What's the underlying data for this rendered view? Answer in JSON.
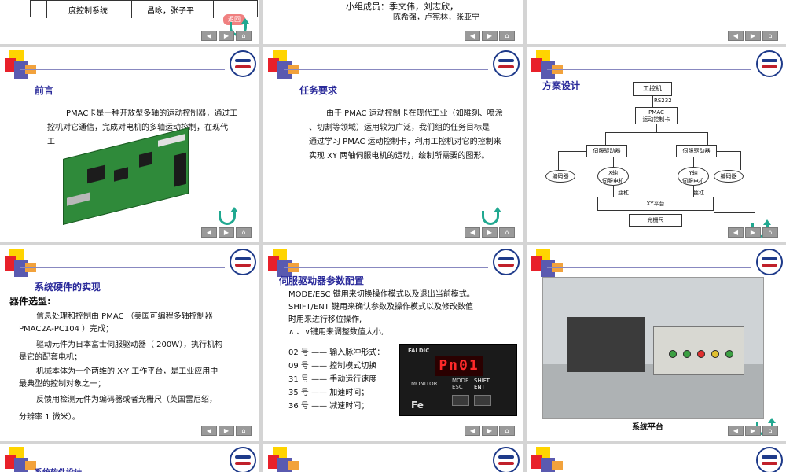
{
  "navbar": {
    "prev": "◀",
    "next": "▶",
    "home": "⌂"
  },
  "slide_top_left": {
    "row_cell_1": "度控制系统",
    "row_cell_2": "昌咏，张子平",
    "badge": "返回"
  },
  "slide_top_mid": {
    "members_label": "小组成员：季文伟，刘志欣，",
    "members_line2": "陈希强，卢宪林，张亚宁"
  },
  "slide_preface": {
    "title": "前言",
    "text_line1": "PMAC卡是一种开放型多轴的运动控制器，通过工",
    "text_line2": "控机对它通信，完成对电机的多轴运动控制，在现代",
    "text_line3": "工"
  },
  "slide_task": {
    "title": "任务要求",
    "text_line1": "由于 PMAC 运动控制卡在现代工业（如雕刻、喷涂",
    "text_line2": "、切割等领域）运用较为广泛，我们组的任务目标是",
    "text_line3": "通过学习 PMAC 运动控制卡，利用工控机对它的控制来",
    "text_line4": "实现 XY 两轴伺服电机的运动，绘制所需要的图形。"
  },
  "slide_design": {
    "title": "方案设计",
    "ipc": "工控机",
    "rs232": "RS232",
    "pmac": "PMAC\n运动控制卡",
    "servo_left": "伺服驱动器",
    "servo_right": "伺服驱动器",
    "encoder_left": "编码器",
    "encoder_right": "编码器",
    "motor_x": "X轴\n伺服电机",
    "motor_y": "Y轴\n伺服电机",
    "screw_left": "丝杠",
    "screw_right": "丝杠",
    "xy_platform": "XY平台",
    "grating": "光栅尺"
  },
  "slide_hardware": {
    "title": "系统硬件的实现",
    "subtitle": "器件选型:",
    "p1_line1": "信息处理和控制由 PMAC （美国可编程多轴控制器",
    "p1_line2": "PMAC2A-PC104 ）完成；",
    "p2_line1": "驱动元件为日本富士伺服驱动器（ 200W），执行机构",
    "p2_line2": "是它的配套电机；",
    "p3_line1": "机械本体为一个两维的 X-Y 工作平台，是工业应用中",
    "p3_line2": "最典型的控制对象之一；",
    "p4_line1": "反馈用检测元件为编码器或者光栅尺（英国雷尼绍，",
    "p4_line2": "分辨率 1 微米）。"
  },
  "slide_servo": {
    "title": "伺服驱动器参数配置",
    "l1": "MODE/ESC 键用来切换操作模式以及退出当前模式。",
    "l2": "SHIFT/ENT 键用来确认参数及操作模式以及修改数值",
    "l3": "时用来进行移位操作,",
    "l4": "∧ 、∨键用来调整数值大小,",
    "items": [
      "02 号 —— 输入脉冲形式：",
      "09 号 —— 控制模式切换",
      "31 号 —— 手动运行速度",
      "35 号 —— 加速时间；",
      "36 号 —— 减速时间；"
    ],
    "panel_brand": "FALDIC",
    "panel_display": "Pn01",
    "panel_monitor": "MONITOR",
    "panel_mode": "MODE\nESC",
    "panel_shift": "SHIFT\nENT",
    "panel_logo": "Fe"
  },
  "slide_platform": {
    "caption": "系统平台"
  },
  "slide_bottom_left": {
    "title_partial": "系统软件设计"
  }
}
